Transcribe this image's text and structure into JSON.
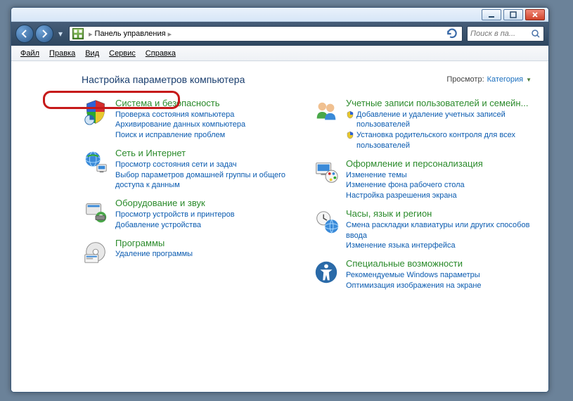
{
  "window": {
    "minimize_tip": "Свернуть",
    "maximize_tip": "Развернуть",
    "close_tip": "Закрыть"
  },
  "address": {
    "crumb1": "Панель управления",
    "search_placeholder": "Поиск в па..."
  },
  "menu": {
    "file": "Файл",
    "edit": "Правка",
    "view": "Вид",
    "tools": "Сервис",
    "help": "Справка"
  },
  "heading": "Настройка параметров компьютера",
  "viewby": {
    "label": "Просмотр:",
    "value": "Категория"
  },
  "left": {
    "c1": {
      "title": "Система и безопасность",
      "s1": "Проверка состояния компьютера",
      "s2": "Архивирование данных компьютера",
      "s3": "Поиск и исправление проблем"
    },
    "c2": {
      "title": "Сеть и Интернет",
      "s1": "Просмотр состояния сети и задач",
      "s2": "Выбор параметров домашней группы и общего доступа к данным"
    },
    "c3": {
      "title": "Оборудование и звук",
      "s1": "Просмотр устройств и принтеров",
      "s2": "Добавление устройства"
    },
    "c4": {
      "title": "Программы",
      "s1": "Удаление программы"
    }
  },
  "right": {
    "c1": {
      "title": "Учетные записи пользователей и семейн...",
      "s1": "Добавление и удаление учетных записей пользователей",
      "s2": "Установка родительского контроля для всех пользователей"
    },
    "c2": {
      "title": "Оформление и персонализация",
      "s1": "Изменение темы",
      "s2": "Изменение фона рабочего стола",
      "s3": "Настройка разрешения экрана"
    },
    "c3": {
      "title": "Часы, язык и регион",
      "s1": "Смена раскладки клавиатуры или других способов ввода",
      "s2": "Изменение языка интерфейса"
    },
    "c4": {
      "title": "Специальные возможности",
      "s1": "Рекомендуемые Windows параметры",
      "s2": "Оптимизация изображения на экране"
    }
  }
}
